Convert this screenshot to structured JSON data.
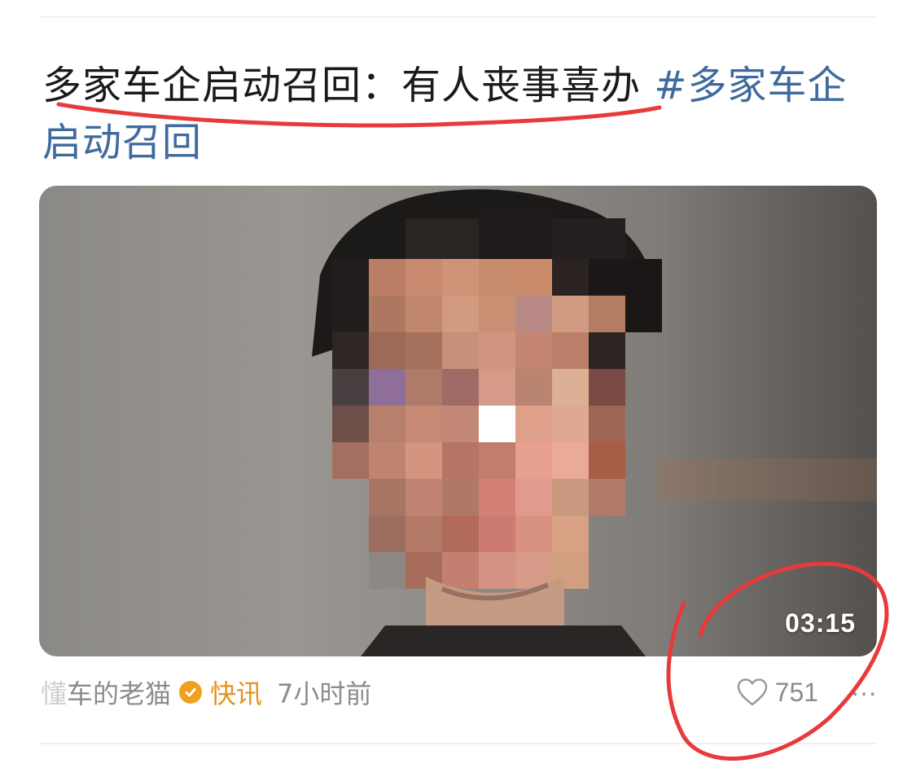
{
  "post": {
    "title": "多家车企启动召回：有人丧事喜办",
    "topic": "#多家车企启动召回",
    "video": {
      "duration": "03:15"
    },
    "meta": {
      "author_prefix": "懂",
      "author_name": "车的老猫",
      "category": "快讯",
      "time": "7小时前"
    },
    "actions": {
      "like_count": "751",
      "more_label": "···"
    }
  },
  "icons": {
    "verified": "verified-badge-icon",
    "like": "heart-icon",
    "more": "more-dots-icon"
  },
  "colors": {
    "topic": "#3f6a9e",
    "category": "#e6921e",
    "annotation": "#e83a3a"
  }
}
